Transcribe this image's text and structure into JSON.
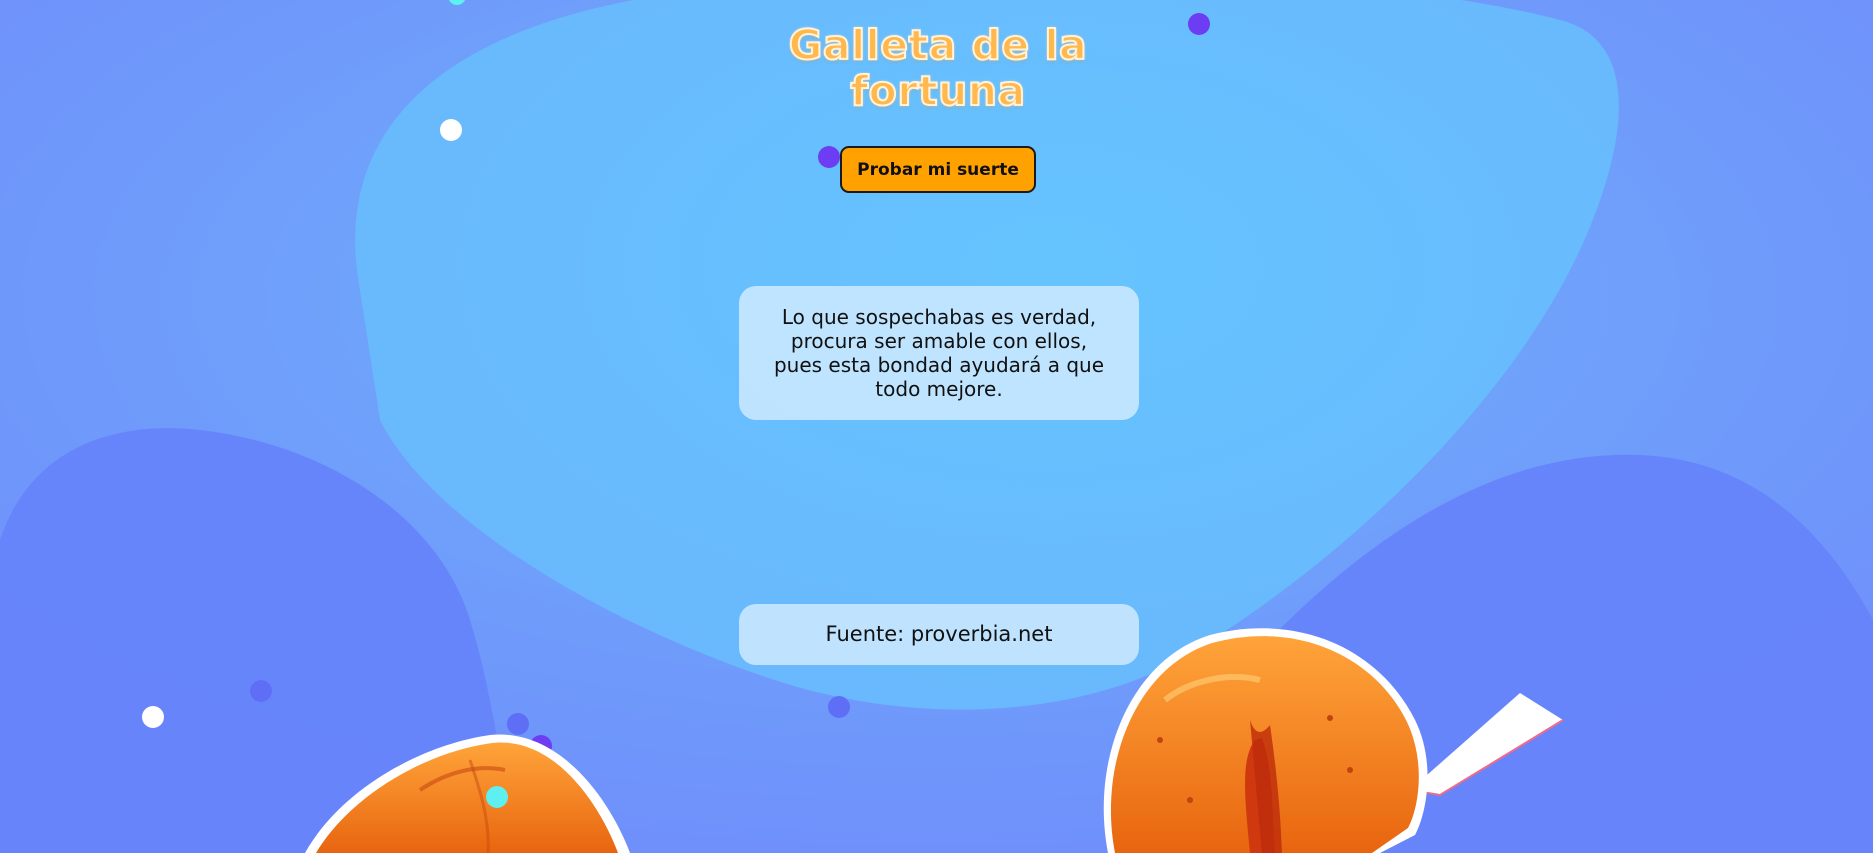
{
  "page": {
    "title": "Galleta de la fortuna"
  },
  "actions": {
    "try_luck_label": "Probar mi suerte"
  },
  "fortune": {
    "message": "Lo que sospechabas es verdad, procura ser amable con ellos, pues esta bondad ayudará a que todo mejore."
  },
  "source": {
    "label": "Fuente: proverbia.net"
  },
  "colors": {
    "background": "#7394fb",
    "blob": "#66c0fd",
    "title": "#ffb84d",
    "button": "#ffa200",
    "card": "#d2ecff"
  }
}
